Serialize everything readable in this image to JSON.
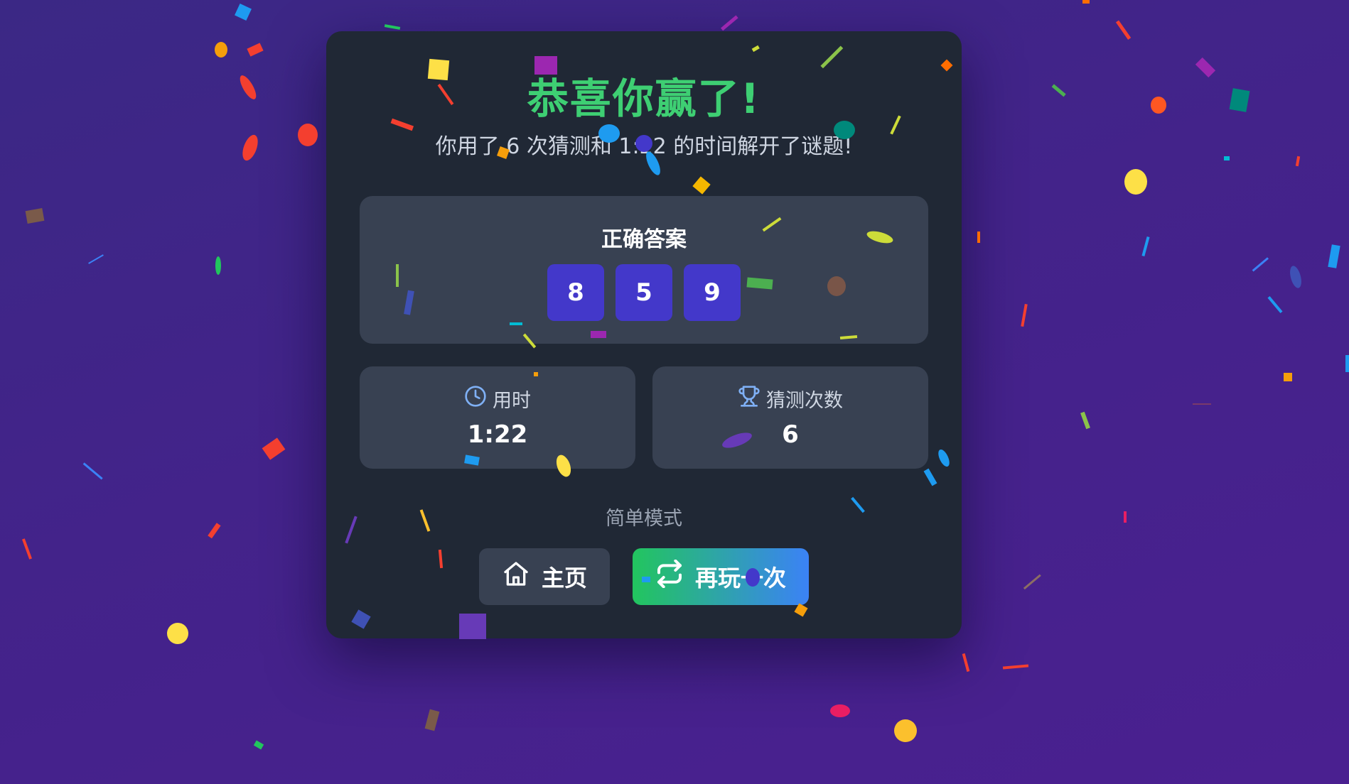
{
  "result": {
    "title": "恭喜你赢了!",
    "subtitle": "你用了 6 次猜测和 1:22 的时间解开了谜题!"
  },
  "answer": {
    "label": "正确答案",
    "digits": [
      "8",
      "5",
      "9"
    ]
  },
  "stats": {
    "time_label": "用时",
    "time_value": "1:22",
    "guesses_label": "猜测次数",
    "guesses_value": "6"
  },
  "mode_label": "简单模式",
  "buttons": {
    "home_label": "主页",
    "replay_label": "再玩一次"
  },
  "colors": {
    "background": "#3f2688",
    "card": "#202835",
    "panel": "#384152",
    "title_green": "#3ecf73",
    "digit_tile": "#4338ca",
    "icon_blue": "#7fb0f5",
    "replay_gradient_start": "#22c55e",
    "replay_gradient_end": "#3b82f6"
  },
  "icons": {
    "time": "clock-icon",
    "guesses": "trophy-icon",
    "home": "home-icon",
    "replay": "repeat-icon"
  }
}
